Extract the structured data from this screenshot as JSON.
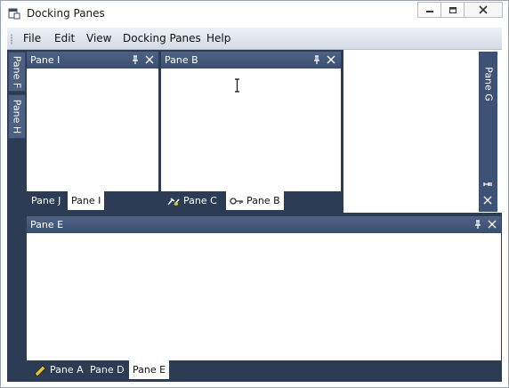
{
  "window": {
    "title": "Docking Panes"
  },
  "menu": [
    "File",
    "Edit",
    "View",
    "Docking Panes",
    "Help"
  ],
  "left_strip": [
    "Pane F",
    "Pane H"
  ],
  "panes": {
    "top_left": {
      "title": "Pane I",
      "tabs": [
        "Pane J",
        "Pane I"
      ],
      "active_tab": "Pane I"
    },
    "top_middle": {
      "title": "Pane B",
      "tabs": [
        "Pane C",
        "Pane B"
      ],
      "active_tab": "Pane B"
    },
    "right": {
      "title": "Pane G"
    },
    "bottom": {
      "title": "Pane E",
      "tabs": [
        "Pane A",
        "Pane D",
        "Pane E"
      ],
      "active_tab": "Pane E"
    }
  },
  "colors": {
    "frame": "#2c3c55",
    "caption": "#4e6286",
    "tab_active": "#ffffff"
  }
}
